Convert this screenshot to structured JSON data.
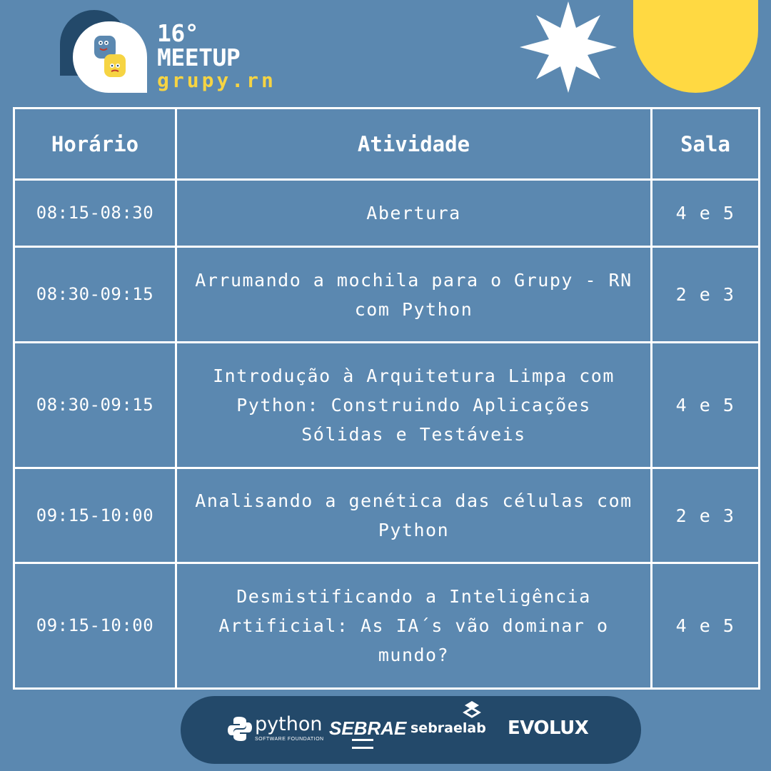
{
  "header": {
    "edition": "16°",
    "event": "MEETUP",
    "group": "grupy.rn"
  },
  "table": {
    "headers": {
      "time": "Horário",
      "activity": "Atividade",
      "room": "Sala"
    },
    "rows": [
      {
        "time": "08:15-08:30",
        "activity": "Abertura",
        "room": "4 e 5"
      },
      {
        "time": "08:30-09:15",
        "activity": "Arrumando a mochila para o Grupy - RN com Python",
        "room": "2 e 3"
      },
      {
        "time": "08:30-09:15",
        "activity": "Introdução à Arquitetura Limpa com Python: Construindo Aplicações Sólidas e Testáveis",
        "room": "4 e 5"
      },
      {
        "time": "09:15-10:00",
        "activity": "Analisando a genética das células com Python",
        "room": "2 e 3"
      },
      {
        "time": "09:15-10:00",
        "activity": "Desmistificando a Inteligência Artificial: As IA´s vão dominar o mundo?",
        "room": "4 e 5"
      }
    ]
  },
  "sponsors": {
    "python": "python",
    "python_sub": "SOFTWARE FOUNDATION",
    "sebrae": "SEBRAE",
    "sebraelab": "sebraelab",
    "evolux": "EVOLUX"
  },
  "colors": {
    "background": "#5b88b0",
    "dark_blue": "#23496a",
    "yellow": "#ffd942",
    "white": "#ffffff"
  },
  "icons": [
    "python-logo-icon",
    "star-icon",
    "sebraelab-icon"
  ]
}
